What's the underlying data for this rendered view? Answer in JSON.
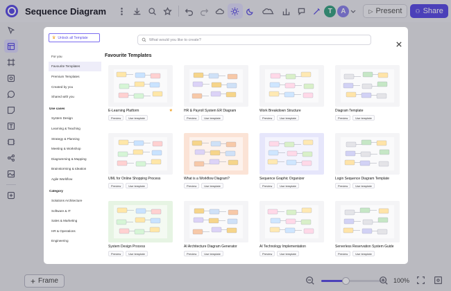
{
  "app": {
    "title": "Sequence Diagram",
    "present_label": "Present",
    "share_label": "Share",
    "avatars": [
      {
        "letter": "T",
        "color": "#3aa383"
      },
      {
        "letter": "A",
        "color": "#8c83ea"
      }
    ],
    "accent": "#5c4ee5"
  },
  "left_toolbar": [
    "cursor-icon",
    "template-icon",
    "frame-icon",
    "shape-icon",
    "comment-icon",
    "sticky-note-icon",
    "text-icon",
    "grid-icon",
    "connector-icon",
    "image-icon",
    "plus-icon"
  ],
  "bottom": {
    "frame_label": "Frame",
    "zoom_label": "100%",
    "zoom_level": 0.38
  },
  "modal": {
    "search_placeholder": "What would you like to create?",
    "unlock_label": "Unlock all Template",
    "sidebar": {
      "top_items": [
        "For you",
        "Favourite Templates",
        "Premium Templates",
        "Created by you",
        "Shared with you"
      ],
      "active_item": "Favourite Templates",
      "use_cases_header": "Use cases",
      "use_cases": [
        "System Design",
        "Learning & Teaching",
        "Strategy & Planning",
        "Meeting & Workshop",
        "Diagramming & Mapping",
        "Brainstorming & Ideation",
        "Agile Workflow"
      ],
      "category_header": "Category",
      "categories": [
        "Solutions Architecture",
        "Software & IT",
        "Sales & Marketing",
        "HR & Operations",
        "Engineering"
      ]
    },
    "section_title": "Favourite Templates",
    "preview_label": "Preview",
    "use_label": "Use template",
    "templates": [
      {
        "title": "E-Learning Platform",
        "starred": true,
        "thumb_bg": "#f4f4f6"
      },
      {
        "title": "HR & Payroll System ER Diagram",
        "starred": false,
        "thumb_bg": "#f4f4f6"
      },
      {
        "title": "Work Breakdown Structure",
        "starred": false,
        "thumb_bg": "#f4f4f6"
      },
      {
        "title": "Diagram Template",
        "starred": false,
        "thumb_bg": "#f4f4f6"
      },
      {
        "title": "UML for Online Shopping Process",
        "starred": false,
        "thumb_bg": "#f4f4f6"
      },
      {
        "title": "What is a Workflow Diagram?",
        "starred": false,
        "thumb_bg": "#fbe3d6"
      },
      {
        "title": "Sequence Graphic Organizer",
        "starred": false,
        "thumb_bg": "#e6e6fb"
      },
      {
        "title": "Login Sequence Diagram Template",
        "starred": false,
        "thumb_bg": "#f4f4f6"
      },
      {
        "title": "System Design Process",
        "starred": false,
        "thumb_bg": "#e6f4e3"
      },
      {
        "title": "AI Architecture Diagram Generator",
        "starred": false,
        "thumb_bg": "#f4f4f6"
      },
      {
        "title": "AI Technology Implementation",
        "starred": false,
        "thumb_bg": "#f4f4f6"
      },
      {
        "title": "Serverless Reservation System Guide",
        "starred": false,
        "thumb_bg": "#f4f4f6"
      }
    ]
  }
}
